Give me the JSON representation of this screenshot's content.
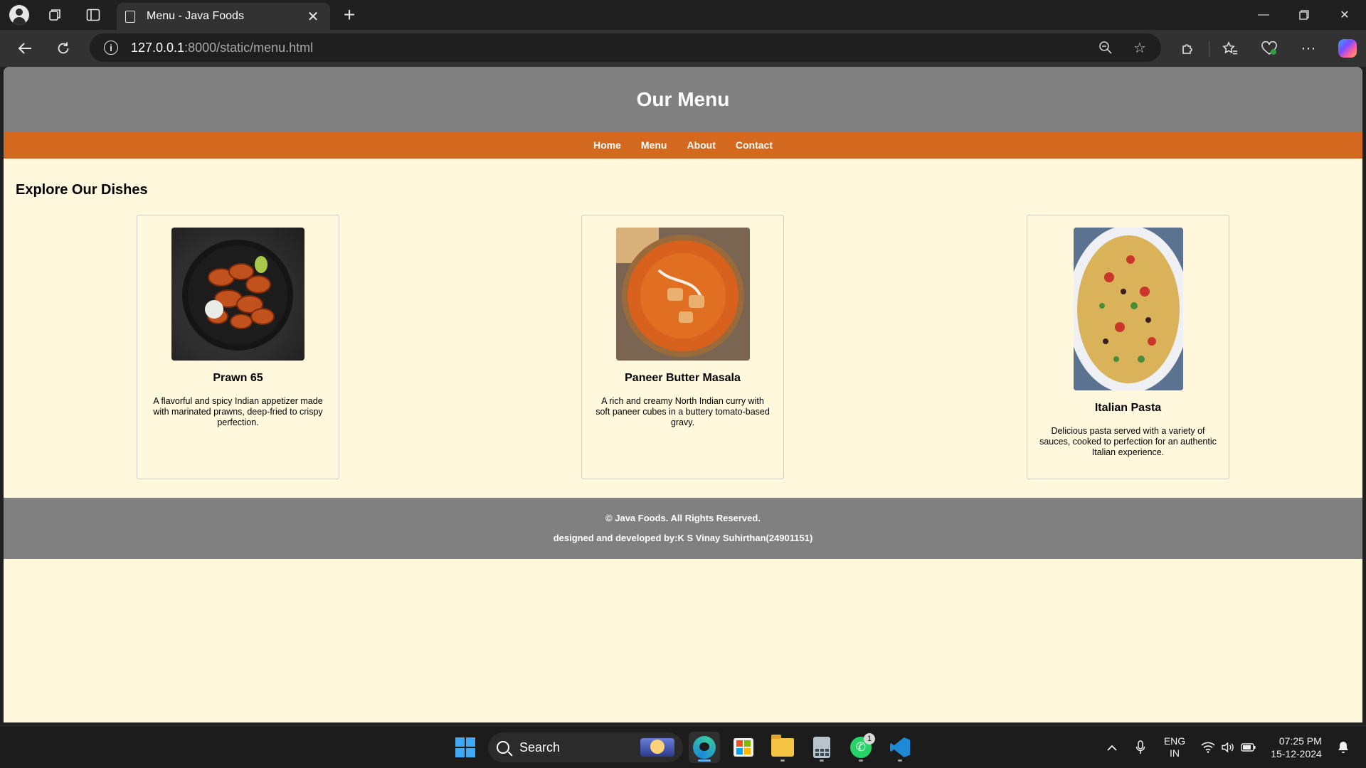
{
  "browser": {
    "tab_title": "Menu - Java Foods",
    "url_host": "127.0.0.1",
    "url_rest": ":8000/static/menu.html"
  },
  "site": {
    "header_title": "Our Menu",
    "nav": [
      "Home",
      "Menu",
      "About",
      "Contact"
    ],
    "section_title": "Explore Our Dishes",
    "dishes": [
      {
        "name": "Prawn 65",
        "description": "A flavorful and spicy Indian appetizer made with marinated prawns, deep-fried to crispy perfection."
      },
      {
        "name": "Paneer Butter Masala",
        "description": "A rich and creamy North Indian curry with soft paneer cubes in a buttery tomato-based gravy."
      },
      {
        "name": "Italian Pasta",
        "description": "Delicious pasta served with a variety of sauces, cooked to perfection for an authentic Italian experience."
      }
    ],
    "footer_line1": "© Java Foods. All Rights Reserved.",
    "footer_line2": "designed and developed by:K S Vinay Suhirthan(24901151)"
  },
  "colors": {
    "header_bg": "#808080",
    "nav_bg": "#d2691e",
    "page_bg": "#fff8dc",
    "footer_bg": "#808080"
  },
  "taskbar": {
    "search_label": "Search",
    "whatsapp_badge": "1",
    "lang_line1": "ENG",
    "lang_line2": "IN",
    "time": "07:25 PM",
    "date": "15-12-2024"
  }
}
